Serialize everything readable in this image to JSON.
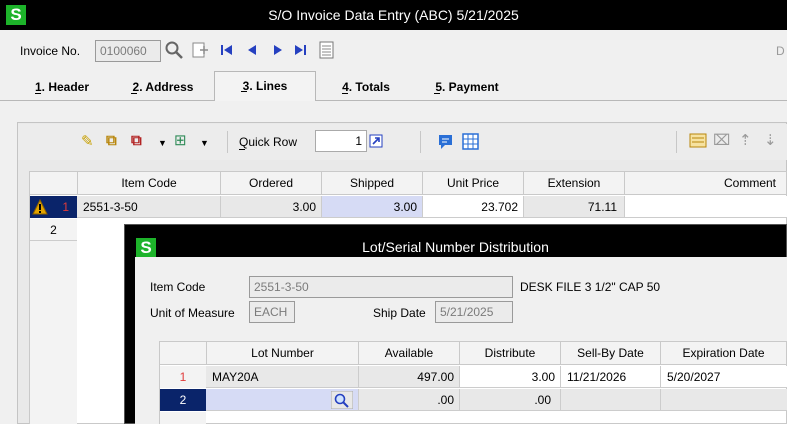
{
  "app": {
    "title": "S/O Invoice Data Entry (ABC) 5/21/2025",
    "logo": "S"
  },
  "invoice": {
    "label": "Invoice No.",
    "value": "0100060",
    "right_cut": "D"
  },
  "tabs": [
    {
      "label": "1. Header",
      "hot": "1"
    },
    {
      "label": "2. Address",
      "hot": "2"
    },
    {
      "label": "3. Lines",
      "hot": "3"
    },
    {
      "label": "4. Totals",
      "hot": "4"
    },
    {
      "label": "5. Payment",
      "hot": "5"
    }
  ],
  "toolbar": {
    "quick_row_label": "Quick Row",
    "quick_row_value": "1"
  },
  "grid": {
    "columns": [
      "Item Code",
      "Ordered",
      "Shipped",
      "Unit Price",
      "Extension",
      "Comment"
    ],
    "rows": [
      {
        "row": "1",
        "item_code": "2551-3-50",
        "ordered": "3.00",
        "shipped": "3.00",
        "unit_price": "23.702",
        "extension": "71.11",
        "comment": ""
      },
      {
        "row": "2",
        "item_code": "",
        "ordered": "",
        "shipped": "",
        "unit_price": "",
        "extension": "",
        "comment": ""
      }
    ]
  },
  "dialog": {
    "title": "Lot/Serial Number Distribution",
    "logo": "S",
    "item_code_label": "Item Code",
    "item_code": "2551-3-50",
    "description": "DESK FILE 3 1/2\" CAP 50",
    "uom_label": "Unit of Measure",
    "uom": "EACH",
    "ship_date_label": "Ship Date",
    "ship_date": "5/21/2025",
    "columns": [
      "Lot Number",
      "Available",
      "Distribute",
      "Sell-By Date",
      "Expiration Date"
    ],
    "rows": [
      {
        "row": "1",
        "lot": "MAY20A",
        "available": "497.00",
        "distribute": "3.00",
        "sell_by": "11/21/2026",
        "expiration": "5/20/2027"
      },
      {
        "row": "2",
        "lot": "",
        "available": ".00",
        "distribute": ".00",
        "sell_by": "",
        "expiration": ""
      }
    ]
  },
  "colors": {
    "accent": "#1db32a",
    "nav_blue": "#2540c0",
    "selected_row": "#0a246a",
    "warning": "#e3a400"
  }
}
